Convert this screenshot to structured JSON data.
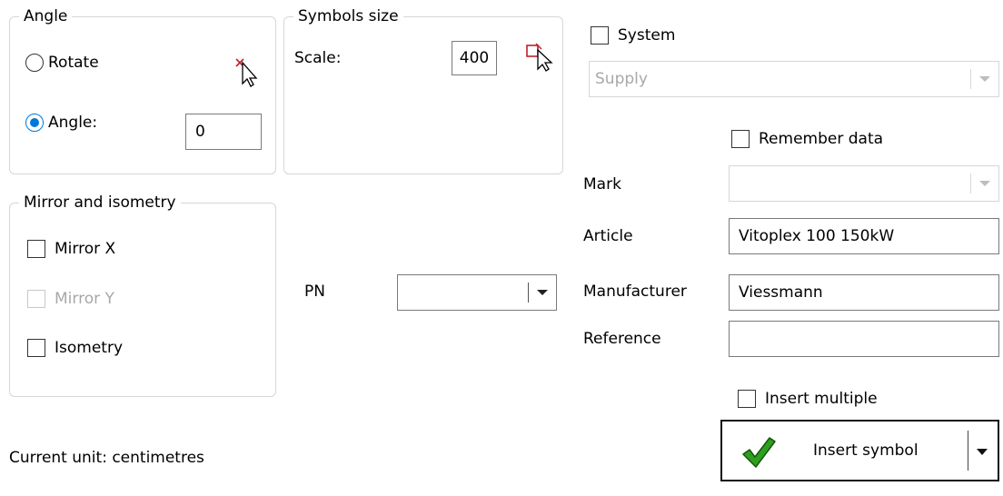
{
  "angle_group": {
    "legend": "Angle",
    "rotate_label": "Rotate",
    "angle_label": "Angle:",
    "angle_value": "0",
    "selected": "Angle:"
  },
  "symbols_size_group": {
    "legend": "Symbols size",
    "scale_label": "Scale:",
    "scale_value": "400"
  },
  "mirror_group": {
    "legend": "Mirror and isometry",
    "mirror_x_label": "Mirror X",
    "mirror_y_label": "Mirror Y",
    "isometry_label": "Isometry"
  },
  "pn": {
    "label": "PN",
    "value": ""
  },
  "system": {
    "checkbox_label": "System",
    "combo_value": "Supply"
  },
  "remember_data_label": "Remember data",
  "fields": {
    "mark_label": "Mark",
    "mark_value": "",
    "article_label": "Article",
    "article_value": "Vitoplex 100 150kW",
    "manufacturer_label": "Manufacturer",
    "manufacturer_value": "Viessmann",
    "reference_label": "Reference",
    "reference_value": ""
  },
  "insert_multiple_label": "Insert multiple",
  "insert_button_label": "Insert symbol",
  "status_text": "Current unit: centimetres",
  "icons": {
    "pick_rotate": "pick-point-cursor-icon",
    "pick_scale": "pick-scale-cursor-icon",
    "insert": "green-checkmark-icon"
  },
  "colors": {
    "accent": "#0078d7",
    "check_green": "#2e9e1e",
    "pick_red": "#c0202a"
  }
}
